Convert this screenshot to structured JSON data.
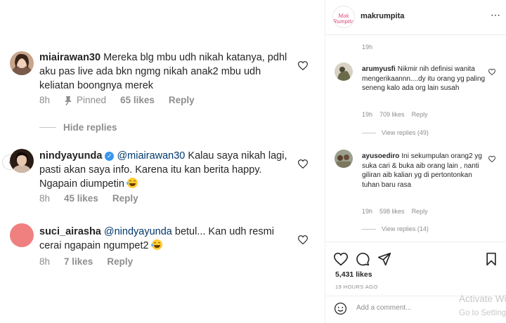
{
  "zoomed_comments": {
    "comment1": {
      "username": "miairawan30",
      "text": "Mereka blg mbu udh nikah katanya, pdhl aku pas live ada bkn ngmg nikah anak2 mbu udh keliatan boongnya merek",
      "time": "8h",
      "pinned_label": "Pinned",
      "likes": "65 likes",
      "reply_label": "Reply"
    },
    "hide_replies_label": "Hide replies",
    "reply1": {
      "username": "nindyayunda",
      "mention": "@miairawan30",
      "text": "Kalau saya nikah lagi, pasti akan saya info. Karena itu kan berita happy. Ngapain diumpetin",
      "emoji": "laughing-tears-emoji",
      "time": "8h",
      "likes": "45 likes",
      "reply_label": "Reply"
    },
    "reply2": {
      "username": "suci_airasha",
      "mention": "@nindyayunda",
      "text": "betul... Kan udh resmi cerai ngapain ngumpet2",
      "emoji": "laughing-tears-emoji",
      "time": "8h",
      "likes": "7 likes",
      "reply_label": "Reply"
    }
  },
  "post": {
    "username": "makrumpita",
    "avatar_text": "Mak Rumpita",
    "top_time": "19h",
    "comments": [
      {
        "username": "arumyusfi",
        "text": "Nikmir nih definisi wanita mengerikaannn....dy itu orang yg paling seneng kalo ada org lain susah",
        "time": "19h",
        "likes": "709 likes",
        "reply_label": "Reply",
        "view_replies": "View replies (49)"
      },
      {
        "username": "ayusoediro",
        "text": "Ini sekumpulan orang2 yg suka cari & buka aib orang lain , nanti giliran aib kalian yg di pertontonkan tuhan baru rasa",
        "time": "19h",
        "likes": "598 likes",
        "reply_label": "Reply",
        "view_replies": "View replies (14)"
      }
    ],
    "likes": "5,431 likes",
    "posted": "19 HOURS AGO",
    "add_comment_placeholder": "Add a comment..."
  },
  "watermark": {
    "line1": "Activate Windows",
    "line2": "Go to Settings to activate Windows."
  },
  "colors": {
    "text": "#262626",
    "muted": "#8e8e8e",
    "mention": "#00376b",
    "verified": "#3897f0",
    "brand": "#d6336c"
  }
}
